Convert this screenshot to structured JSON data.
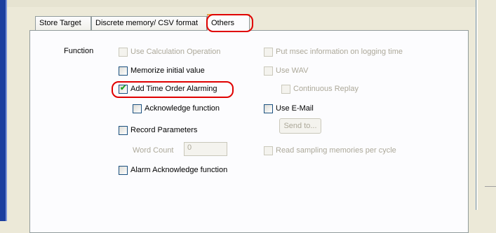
{
  "tabs": [
    {
      "label": "Store Target"
    },
    {
      "label": "Discrete memory/ CSV format"
    },
    {
      "label": "Others"
    }
  ],
  "section_label": "Function",
  "options": {
    "use_calculation_operation": {
      "label": "Use Calculation Operation",
      "checked": false,
      "enabled": false
    },
    "memorize_initial_value": {
      "label": "Memorize initial value",
      "checked": false,
      "enabled": true
    },
    "add_time_order_alarming": {
      "label": "Add Time Order Alarming",
      "checked": true,
      "enabled": true
    },
    "acknowledge_function": {
      "label": "Acknowledge function",
      "checked": false,
      "enabled": true
    },
    "record_parameters": {
      "label": "Record Parameters",
      "checked": false,
      "enabled": true
    },
    "alarm_acknowledge_function": {
      "label": "Alarm Acknowledge function",
      "checked": false,
      "enabled": true
    },
    "put_msec_information": {
      "label": "Put msec information on logging time",
      "checked": false,
      "enabled": false
    },
    "use_wav": {
      "label": "Use WAV",
      "checked": false,
      "enabled": false
    },
    "continuous_replay": {
      "label": "Continuous Replay",
      "checked": false,
      "enabled": false
    },
    "use_email": {
      "label": "Use E-Mail",
      "checked": false,
      "enabled": true
    },
    "read_sampling_memories": {
      "label": "Read sampling memories per cycle",
      "checked": false,
      "enabled": false
    }
  },
  "word_count": {
    "label": "Word Count",
    "value": "0"
  },
  "send_to_button": {
    "label": "Send to..."
  },
  "colors": {
    "highlight": "#e00000",
    "check": "#21a121",
    "disabled_text": "#aca899"
  }
}
